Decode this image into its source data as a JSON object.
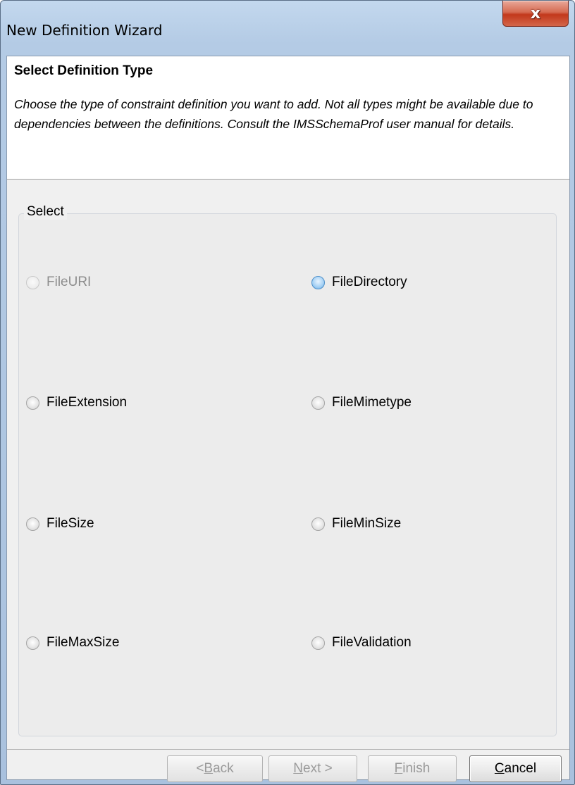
{
  "window": {
    "title": "New Definition Wizard",
    "close_glyph": "x",
    "close_icon": "close-icon"
  },
  "header": {
    "title": "Select Definition Type",
    "description": "Choose the type of constraint definition you want to add. Not all types might be available due to dependencies between the definitions. Consult the IMSSchemaProf user manual for details."
  },
  "group": {
    "legend": "Select",
    "options": [
      {
        "label": "FileURI",
        "enabled": false,
        "selected": false
      },
      {
        "label": "FileDirectory",
        "enabled": true,
        "selected": false,
        "focused": true
      },
      {
        "label": "FileExtension",
        "enabled": true,
        "selected": false
      },
      {
        "label": "FileMimetype",
        "enabled": true,
        "selected": false
      },
      {
        "label": "FileSize",
        "enabled": true,
        "selected": false
      },
      {
        "label": "FileMinSize",
        "enabled": true,
        "selected": false
      },
      {
        "label": "FileMaxSize",
        "enabled": true,
        "selected": false
      },
      {
        "label": "FileValidation",
        "enabled": true,
        "selected": false
      }
    ]
  },
  "buttons": {
    "back": {
      "pre": "< ",
      "mnemonic": "B",
      "rest": "ack",
      "enabled": false
    },
    "next": {
      "pre": "",
      "mnemonic": "N",
      "rest": "ext >",
      "enabled": false
    },
    "finish": {
      "pre": "",
      "mnemonic": "F",
      "rest": "inish",
      "enabled": false
    },
    "cancel": {
      "pre": "",
      "mnemonic": "C",
      "rest": "ancel",
      "enabled": true
    }
  },
  "colors": {
    "titlebar": "#b4cbe5",
    "close_red": "#c2381b",
    "disabled_text": "#8d8d8d",
    "focus_radio": "#6aaee5"
  }
}
